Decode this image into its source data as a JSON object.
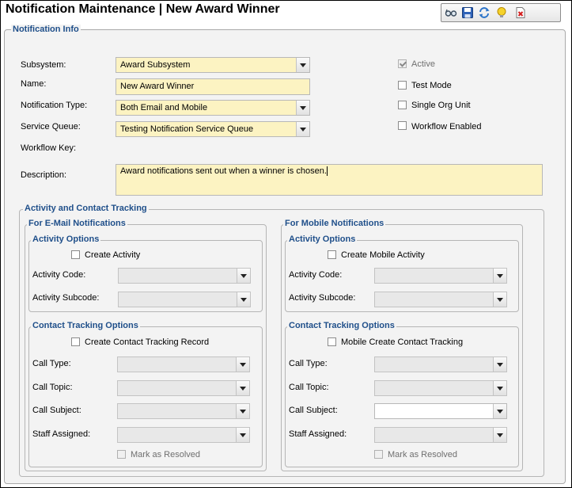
{
  "window": {
    "title": "Notification Maintenance  |  New Award Winner"
  },
  "toolbar": {
    "icons": [
      "glasses-icon",
      "save-icon",
      "refresh-icon",
      "lightbulb-icon",
      "delete-icon"
    ]
  },
  "notification_info": {
    "legend": "Notification Info",
    "subsystem": {
      "label": "Subsystem:",
      "value": "Award Subsystem"
    },
    "name": {
      "label": "Name:",
      "value": "New Award Winner"
    },
    "notification_type": {
      "label": "Notification Type:",
      "value": "Both Email and Mobile"
    },
    "service_queue": {
      "label": "Service Queue:",
      "value": "Testing Notification Service Queue"
    },
    "workflow_key": {
      "label": "Workflow Key:"
    },
    "description": {
      "label": "Description:",
      "value": "Award notifications sent out when a winner is chosen."
    },
    "active": {
      "label": "Active",
      "checked": true
    },
    "test_mode": {
      "label": "Test Mode"
    },
    "single_org_unit": {
      "label": "Single Org Unit"
    },
    "workflow_enabled": {
      "label": "Workflow Enabled"
    }
  },
  "tracking": {
    "legend": "Activity and Contact Tracking",
    "email": {
      "legend": "For E-Mail Notifications",
      "activity_legend": "Activity Options",
      "create_activity": "Create Activity",
      "activity_code": "Activity Code:",
      "activity_subcode": "Activity Subcode:",
      "contact_legend": "Contact Tracking Options",
      "create_contact": "Create Contact Tracking Record",
      "call_type": "Call Type:",
      "call_topic": "Call Topic:",
      "call_subject": "Call Subject:",
      "staff_assigned": "Staff Assigned:",
      "mark_resolved": "Mark as Resolved"
    },
    "mobile": {
      "legend": "For Mobile Notifications",
      "activity_legend": "Activity Options",
      "create_activity": "Create Mobile Activity",
      "activity_code": "Activity Code:",
      "activity_subcode": "Activity Subcode:",
      "contact_legend": "Contact Tracking Options",
      "create_contact": "Mobile Create Contact Tracking",
      "call_type": "Call Type:",
      "call_topic": "Call Topic:",
      "call_subject": "Call Subject:",
      "staff_assigned": "Staff Assigned:",
      "mark_resolved": "Mark as Resolved"
    }
  }
}
